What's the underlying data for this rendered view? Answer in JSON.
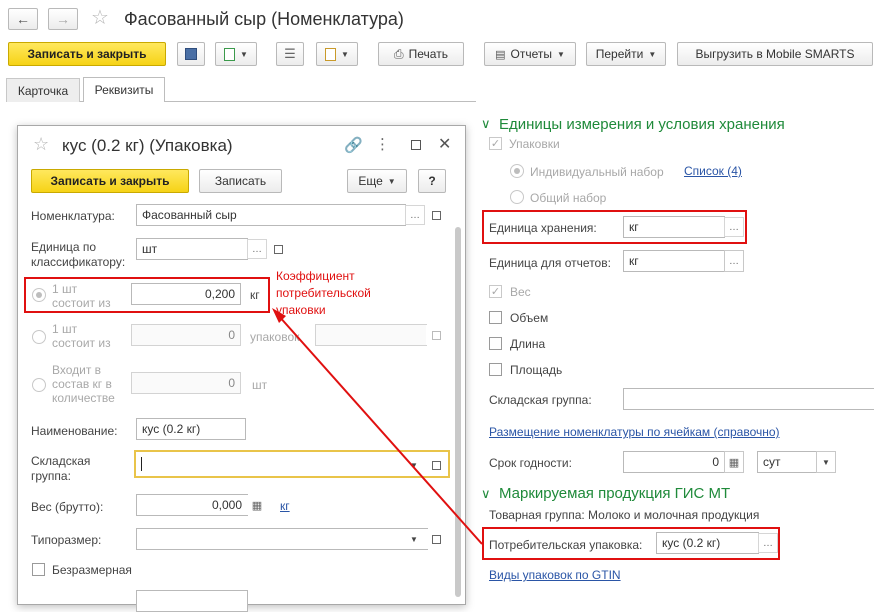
{
  "window": {
    "title": "Фасованный сыр (Номенклатура)"
  },
  "toolbar": {
    "save_close": "Записать и закрыть",
    "print": "Печать",
    "reports": "Отчеты",
    "goto": "Перейти",
    "export": "Выгрузить в Mobile SMARTS"
  },
  "tabs": [
    "Карточка",
    "Реквизиты"
  ],
  "dialog": {
    "title": "кус (0.2 кг) (Упаковка)",
    "save_close": "Записать и закрыть",
    "save": "Записать",
    "more": "Еще",
    "help": "?",
    "nomenclature_label": "Номенклатура:",
    "nomenclature_value": "Фасованный сыр",
    "unit_label": "Единица по классификатору:",
    "unit_value": "шт",
    "radio1_label": "1 шт состоит из",
    "radio1_value": "0,200",
    "radio1_unit": "кг",
    "radio2_label": "1 шт состоит из",
    "radio2_value": "0",
    "radio2_unit": "упаковок",
    "radio3_label": "Входит в состав кг в количестве",
    "radio3_value": "0",
    "radio3_unit": "шт",
    "name_label": "Наименование:",
    "name_value": "кус (0.2 кг)",
    "warehouse_group_label": "Складская группа:",
    "weight_label": "Вес (брутто):",
    "weight_value": "0,000",
    "weight_unit": "кг",
    "size_label": "Типоразмер:",
    "sizeless_label": "Безразмерная",
    "annotation": "Коэффициент потребительской упаковки"
  },
  "right": {
    "units_title": "Единицы измерения и условия хранения",
    "packages": "Упаковки",
    "individual_set": "Индивидуальный набор",
    "list_link": "Список (4)",
    "common_set": "Общий набор",
    "storage_unit_label": "Единица хранения:",
    "storage_unit_value": "кг",
    "report_unit_label": "Единица для отчетов:",
    "report_unit_value": "кг",
    "weight": "Вес",
    "volume": "Объем",
    "length": "Длина",
    "area": "Площадь",
    "warehouse_group_label": "Складская группа:",
    "placement_link": "Размещение номенклатуры по ячейкам (справочно)",
    "shelf_life_label": "Срок годности:",
    "shelf_life_value": "0",
    "shelf_life_unit": "сут",
    "marked_title": "Маркируемая продукция ГИС МТ",
    "product_group": "Товарная группа: Молоко и молочная продукция",
    "consumer_pack_label": "Потребительская упаковка:",
    "consumer_pack_value": "кус (0.2 кг)",
    "gtin_link": "Виды упаковок по GTIN"
  }
}
